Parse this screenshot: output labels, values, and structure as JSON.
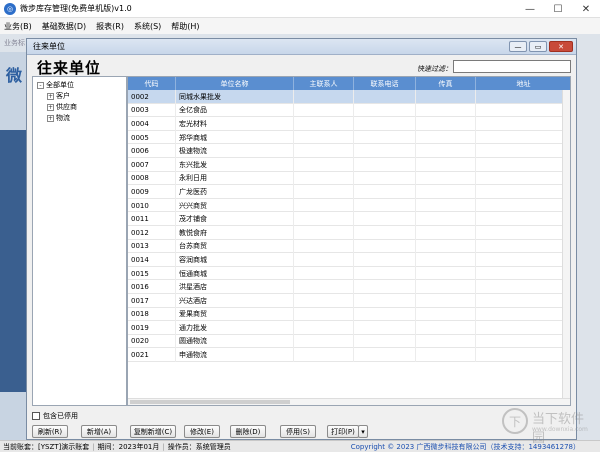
{
  "app": {
    "title": "微步库存管理(免费单机版)v1.0"
  },
  "window_controls": {
    "minimize": "—",
    "maximize": "☐",
    "close": "✕"
  },
  "menu": [
    "业务(B)",
    "基础数据(D)",
    "报表(R)",
    "系统(S)",
    "帮助(H)"
  ],
  "background": {
    "strip_label": "业务标",
    "left_big": "微"
  },
  "dialog": {
    "title": "往来单位",
    "heading": "往来单位",
    "controls": {
      "minimize": "—",
      "restore": "▭",
      "close": "✕"
    },
    "search_label": "快速过滤：",
    "search_value": ""
  },
  "tree": [
    {
      "label": "全部单位",
      "level": 0,
      "expander": "-"
    },
    {
      "label": "客户",
      "level": 1,
      "expander": "+"
    },
    {
      "label": "供应商",
      "level": 1,
      "expander": "+"
    },
    {
      "label": "物流",
      "level": 1,
      "expander": "+"
    }
  ],
  "grid": {
    "columns": [
      "代码",
      "单位名称",
      "主联系人",
      "联系电话",
      "传真",
      "地址"
    ],
    "selected_index": 0,
    "rows": [
      [
        "0002",
        "同城水果批发",
        "",
        "",
        "",
        ""
      ],
      [
        "0003",
        "全亿食品",
        "",
        "",
        "",
        ""
      ],
      [
        "0004",
        "宏光材料",
        "",
        "",
        "",
        ""
      ],
      [
        "0005",
        "郑华商城",
        "",
        "",
        "",
        ""
      ],
      [
        "0006",
        "极速物流",
        "",
        "",
        "",
        ""
      ],
      [
        "0007",
        "东兴批发",
        "",
        "",
        "",
        ""
      ],
      [
        "0008",
        "永利日用",
        "",
        "",
        "",
        ""
      ],
      [
        "0009",
        "广龙医药",
        "",
        "",
        "",
        ""
      ],
      [
        "0010",
        "兴兴商贸",
        "",
        "",
        "",
        ""
      ],
      [
        "0011",
        "茂才铺食",
        "",
        "",
        "",
        ""
      ],
      [
        "0012",
        "教悦食府",
        "",
        "",
        "",
        ""
      ],
      [
        "0013",
        "台苏商贸",
        "",
        "",
        "",
        ""
      ],
      [
        "0014",
        "容润商城",
        "",
        "",
        "",
        ""
      ],
      [
        "0015",
        "恒通商城",
        "",
        "",
        "",
        ""
      ],
      [
        "0016",
        "洪星酒店",
        "",
        "",
        "",
        ""
      ],
      [
        "0017",
        "兴达酒店",
        "",
        "",
        "",
        ""
      ],
      [
        "0018",
        "爱果商贸",
        "",
        "",
        "",
        ""
      ],
      [
        "0019",
        "通力批发",
        "",
        "",
        "",
        ""
      ],
      [
        "0020",
        "圆通物流",
        "",
        "",
        "",
        ""
      ],
      [
        "0021",
        "申通物流",
        "",
        "",
        "",
        ""
      ]
    ]
  },
  "include_disabled": {
    "label": "包含已停用",
    "checked": false
  },
  "buttons": [
    "刷新(R)",
    "新增(A)",
    "复制新增(C)",
    "修改(E)",
    "删除(D)",
    "停用(S)",
    "打印(P)"
  ],
  "print_dropdown": "▾",
  "status": {
    "account": "当前账套：[YSZT]演示账套",
    "period": "期间：2023年01月",
    "operator": "操作员：系统管理员",
    "copyright": "Copyright © 2023 广西微步科技有限公司（技术支持：1493461278）"
  },
  "watermark": {
    "line1": "当下软件园",
    "line2": "www.downxia.com",
    "icon": "下"
  },
  "colors": {
    "grid_header": "#5a8ed0",
    "selected_row": "#c6d8ee",
    "copyright": "#1b4fb0"
  }
}
